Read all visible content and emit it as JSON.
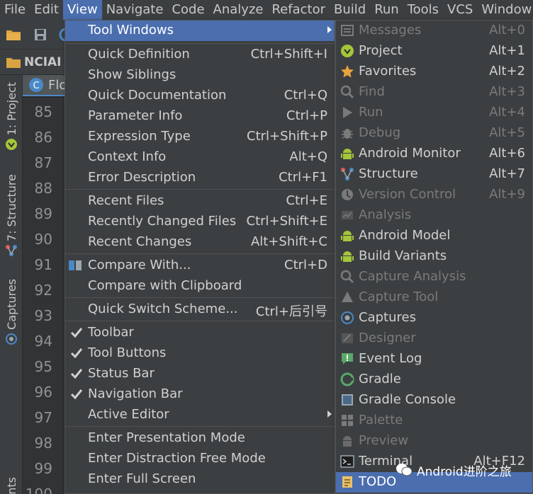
{
  "menubar": {
    "items": [
      "File",
      "Edit",
      "View",
      "Navigate",
      "Code",
      "Analyze",
      "Refactor",
      "Build",
      "Run",
      "Tools",
      "VCS",
      "Window"
    ]
  },
  "navbar": {
    "project_crumb": "NCIAI"
  },
  "editor": {
    "tab_label": "Flo"
  },
  "left_strip": {
    "project_tab": "1: Project",
    "structure_tab": "7: Structure",
    "captures_tab": "Captures",
    "bottom_tab": "nts"
  },
  "gutter": {
    "lines": [
      "85",
      "86",
      "87",
      "88",
      "89",
      "90",
      "91",
      "92",
      "93",
      "94",
      "95",
      "96",
      "97",
      "98",
      "99",
      "100"
    ]
  },
  "view_menu": {
    "tool_windows": "Tool Windows",
    "quick_definition": {
      "label": "Quick Definition",
      "shortcut": "Ctrl+Shift+I"
    },
    "show_siblings": {
      "label": "Show Siblings",
      "shortcut": ""
    },
    "quick_documentation": {
      "label": "Quick Documentation",
      "shortcut": "Ctrl+Q"
    },
    "parameter_info": {
      "label": "Parameter Info",
      "shortcut": "Ctrl+P"
    },
    "expression_type": {
      "label": "Expression Type",
      "shortcut": "Ctrl+Shift+P"
    },
    "context_info": {
      "label": "Context Info",
      "shortcut": "Alt+Q"
    },
    "error_description": {
      "label": "Error Description",
      "shortcut": "Ctrl+F1"
    },
    "recent_files": {
      "label": "Recent Files",
      "shortcut": "Ctrl+E"
    },
    "recently_changed_files": {
      "label": "Recently Changed Files",
      "shortcut": "Ctrl+Shift+E"
    },
    "recent_changes": {
      "label": "Recent Changes",
      "shortcut": "Alt+Shift+C"
    },
    "compare_with": {
      "label": "Compare With...",
      "shortcut": "Ctrl+D"
    },
    "compare_with_clipboard": {
      "label": "Compare with Clipboard",
      "shortcut": ""
    },
    "quick_switch_scheme": {
      "label": "Quick Switch Scheme...",
      "shortcut": "Ctrl+后引号"
    },
    "toolbar": {
      "label": "Toolbar",
      "checked": true
    },
    "tool_buttons": {
      "label": "Tool Buttons",
      "checked": true
    },
    "status_bar": {
      "label": "Status Bar",
      "checked": true
    },
    "navigation_bar": {
      "label": "Navigation Bar",
      "checked": true
    },
    "active_editor": {
      "label": "Active Editor"
    },
    "enter_presentation_mode": "Enter Presentation Mode",
    "enter_distraction_free_mode": "Enter Distraction Free Mode",
    "enter_full_screen": "Enter Full Screen"
  },
  "tool_windows_menu": {
    "items": [
      {
        "label": "Messages",
        "shortcut": "Alt+0",
        "icon": "messages-icon",
        "enabled": false
      },
      {
        "label": "Project",
        "shortcut": "Alt+1",
        "icon": "android-project-icon",
        "enabled": true
      },
      {
        "label": "Favorites",
        "shortcut": "Alt+2",
        "icon": "star-icon",
        "enabled": true
      },
      {
        "label": "Find",
        "shortcut": "Alt+3",
        "icon": "find-icon",
        "enabled": false
      },
      {
        "label": "Run",
        "shortcut": "Alt+4",
        "icon": "run-icon",
        "enabled": false
      },
      {
        "label": "Debug",
        "shortcut": "Alt+5",
        "icon": "debug-icon",
        "enabled": false
      },
      {
        "label": "Android Monitor",
        "shortcut": "Alt+6",
        "icon": "android-icon",
        "enabled": true
      },
      {
        "label": "Structure",
        "shortcut": "Alt+7",
        "icon": "structure-icon",
        "enabled": true
      },
      {
        "label": "Version Control",
        "shortcut": "Alt+9",
        "icon": "version-control-icon",
        "enabled": false
      },
      {
        "label": "Analysis",
        "shortcut": "",
        "icon": "analysis-icon",
        "enabled": false
      },
      {
        "label": "Android Model",
        "shortcut": "",
        "icon": "android-icon",
        "enabled": true
      },
      {
        "label": "Build Variants",
        "shortcut": "",
        "icon": "android-icon",
        "enabled": true
      },
      {
        "label": "Capture Analysis",
        "shortcut": "",
        "icon": "capture-analysis-icon",
        "enabled": false
      },
      {
        "label": "Capture Tool",
        "shortcut": "",
        "icon": "capture-tool-icon",
        "enabled": false
      },
      {
        "label": "Captures",
        "shortcut": "",
        "icon": "captures-icon",
        "enabled": true
      },
      {
        "label": "Designer",
        "shortcut": "",
        "icon": "designer-icon",
        "enabled": false
      },
      {
        "label": "Event Log",
        "shortcut": "",
        "icon": "event-log-icon",
        "enabled": true
      },
      {
        "label": "Gradle",
        "shortcut": "",
        "icon": "gradle-icon",
        "enabled": true
      },
      {
        "label": "Gradle Console",
        "shortcut": "",
        "icon": "gradle-console-icon",
        "enabled": true
      },
      {
        "label": "Palette",
        "shortcut": "",
        "icon": "palette-icon",
        "enabled": false
      },
      {
        "label": "Preview",
        "shortcut": "",
        "icon": "preview-icon",
        "enabled": false
      },
      {
        "label": "Terminal",
        "shortcut": "Alt+F12",
        "icon": "terminal-icon",
        "enabled": true
      },
      {
        "label": "TODO",
        "shortcut": "",
        "icon": "todo-icon",
        "enabled": true
      }
    ]
  },
  "watermark": {
    "text": "Android进阶之旅"
  },
  "colors": {
    "menu_bg": "#3c3f41",
    "selection": "#4b6eaf",
    "disabled_text": "#7a7a7a",
    "android_green": "#a4c639"
  }
}
